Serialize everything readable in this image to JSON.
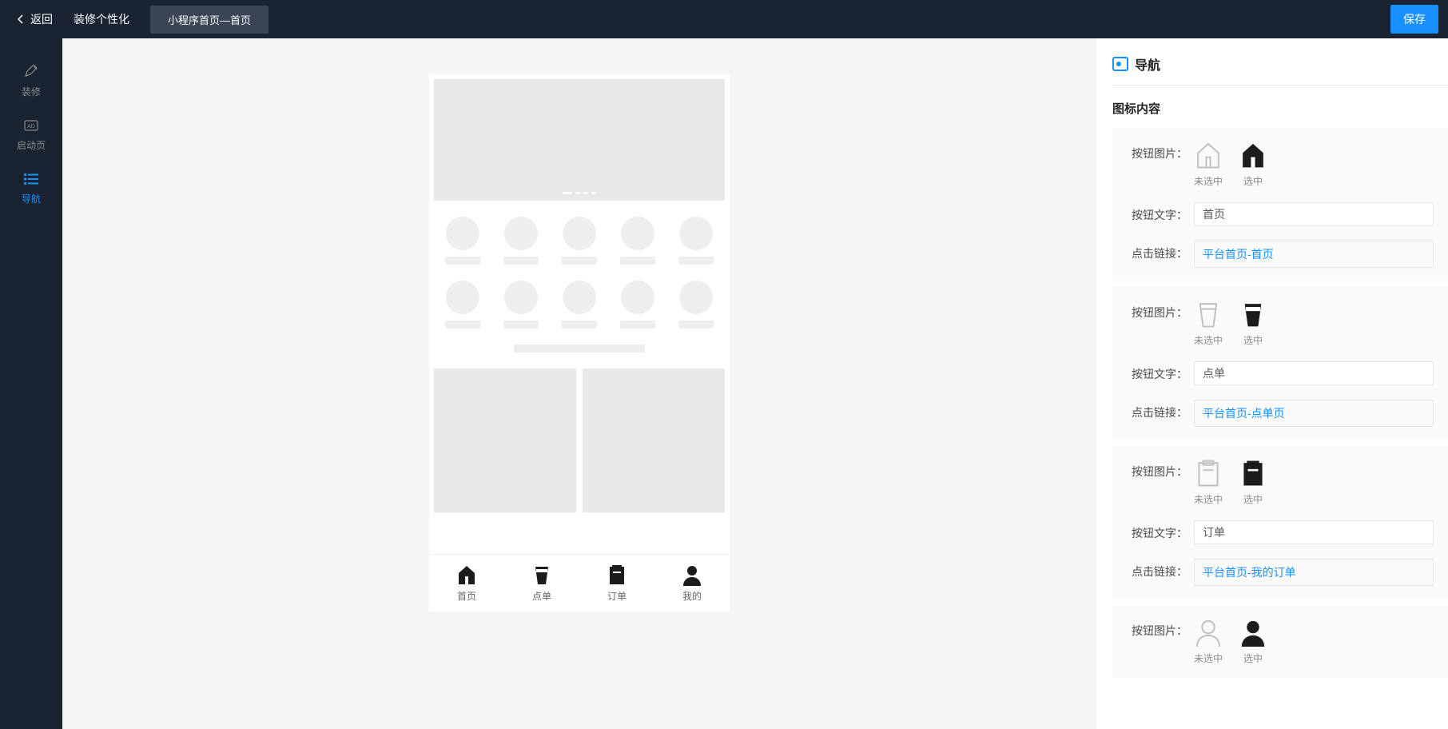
{
  "header": {
    "back_label": "返回",
    "breadcrumb": "装修个性化",
    "page_badge": "小程序首页—首页",
    "save_label": "保存"
  },
  "sidebar": {
    "items": [
      {
        "label": "装修",
        "icon": "edit"
      },
      {
        "label": "启动页",
        "icon": "image"
      },
      {
        "label": "导航",
        "icon": "list",
        "active": true
      }
    ]
  },
  "phone": {
    "tabbar": [
      {
        "label": "首页",
        "icon": "home"
      },
      {
        "label": "点单",
        "icon": "cup"
      },
      {
        "label": "订单",
        "icon": "order"
      },
      {
        "label": "我的",
        "icon": "user"
      }
    ]
  },
  "panel": {
    "title": "导航",
    "section_title": "图标内容",
    "labels": {
      "button_image": "按钮图片：",
      "button_text": "按钮文字：",
      "click_link": "点击链接：",
      "unselected": "未选中",
      "selected": "选中"
    },
    "nav_items": [
      {
        "text": "首页",
        "link": "平台首页-首页",
        "icon": "home"
      },
      {
        "text": "点单",
        "link": "平台首页-点单页",
        "icon": "cup"
      },
      {
        "text": "订单",
        "link": "平台首页-我的订单",
        "icon": "order"
      },
      {
        "text": "",
        "link": "",
        "icon": "user",
        "partial": true
      }
    ]
  }
}
